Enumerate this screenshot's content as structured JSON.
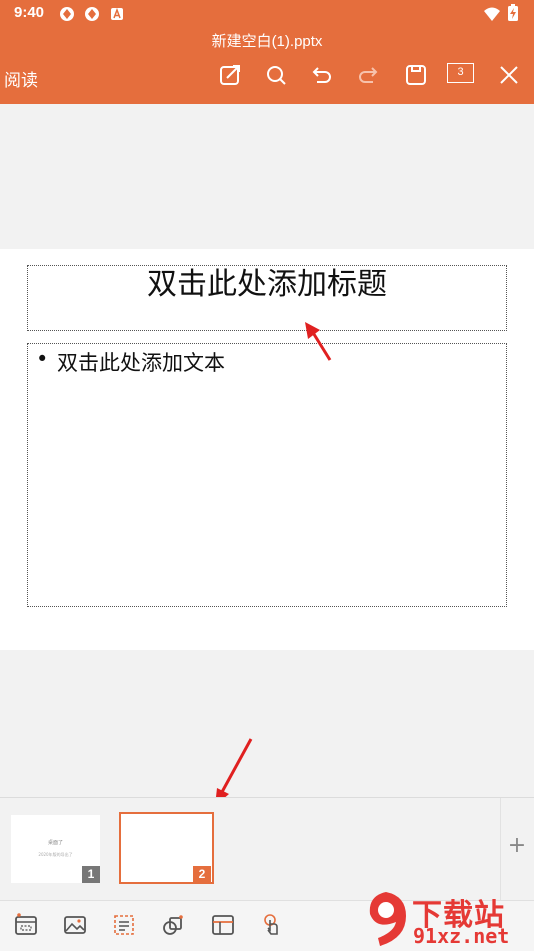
{
  "status_bar": {
    "time": "9:40",
    "battery_symbol": "⚡"
  },
  "header": {
    "document_title": "新建空白(1).pptx",
    "read_label": "阅读",
    "page_count": "3"
  },
  "toolbar_icons": [
    "edit-icon",
    "search-icon",
    "undo-icon",
    "redo-icon",
    "save-icon",
    "page-count-badge",
    "close-icon"
  ],
  "slide": {
    "title_placeholder": "双击此处添加标题",
    "bullet": "•",
    "body_placeholder": "双击此处添加文本"
  },
  "thumbnails": [
    {
      "number": "1",
      "title": "桌面了",
      "subtitle": "2020年版的导出了"
    },
    {
      "number": "2"
    }
  ],
  "add_slide_label": "+",
  "bottom_tools": [
    "slide-layout-icon",
    "image-icon",
    "text-box-icon",
    "shape-icon",
    "table-icon",
    "touch-icon"
  ],
  "watermark": {
    "text_main": "下载站",
    "text_site": "91xz.net",
    "logo_symbol": "9"
  },
  "colors": {
    "brand": "#e56e3d",
    "annotation_arrow": "#e02020",
    "watermark": "#e53935"
  }
}
